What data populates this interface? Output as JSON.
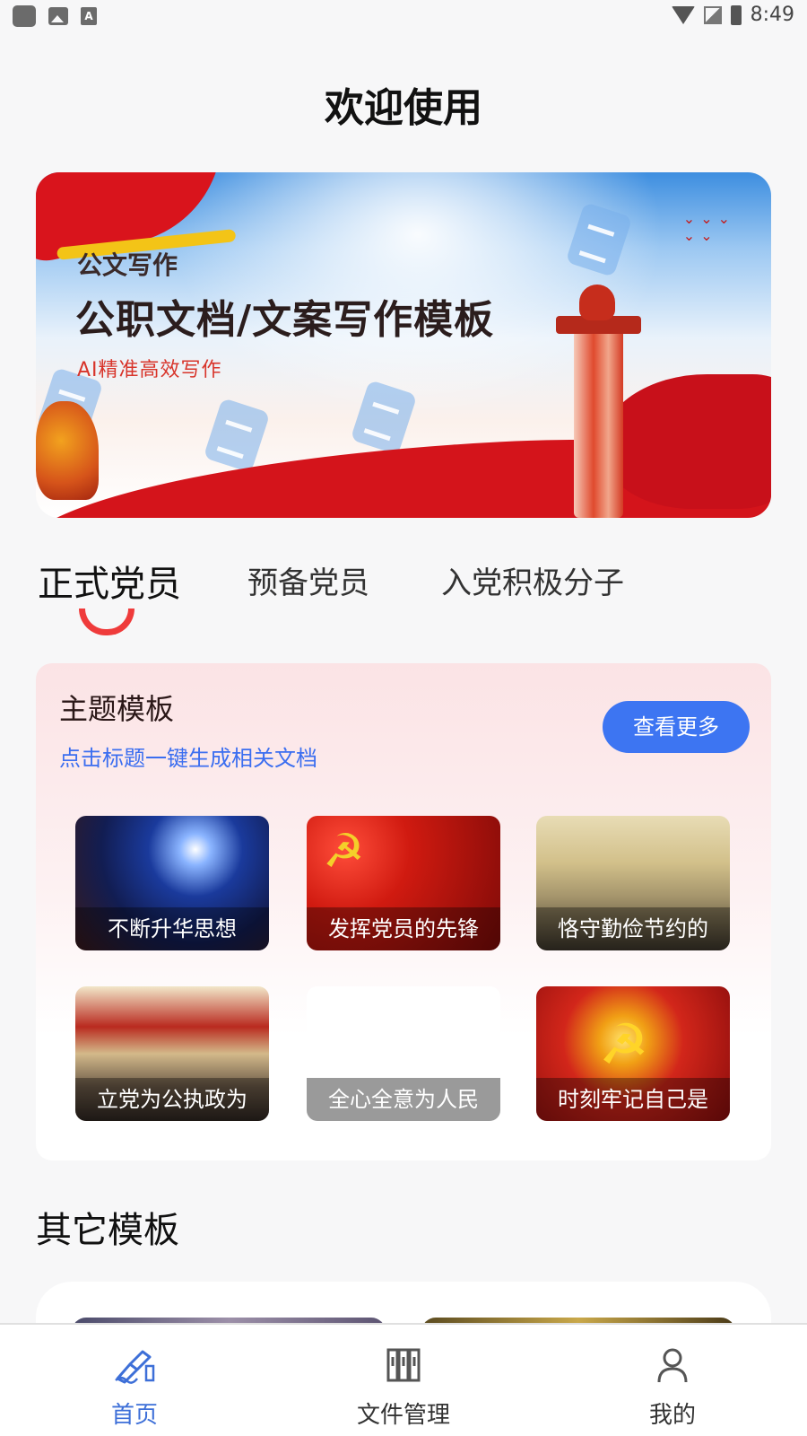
{
  "status_bar": {
    "time": "8:49",
    "left_badge": "A"
  },
  "page_title": "欢迎使用",
  "banner": {
    "label_small": "公文写作",
    "title": "公职文档/文案写作模板",
    "tagline": "AI精准高效写作"
  },
  "tabs": [
    {
      "label": "正式党员",
      "active": true
    },
    {
      "label": "预备党员",
      "active": false
    },
    {
      "label": "入党积极分子",
      "active": false
    }
  ],
  "theme_section": {
    "title": "主题模板",
    "subtitle": "点击标题一键生成相关文档",
    "more_button": "查看更多",
    "tiles": [
      {
        "caption": "不断升华思想"
      },
      {
        "caption": "发挥党员的先锋"
      },
      {
        "caption": "恪守勤俭节约的"
      },
      {
        "caption": "立党为公执政为"
      },
      {
        "caption": "全心全意为人民"
      },
      {
        "caption": "时刻牢记自己是"
      }
    ]
  },
  "other_section": {
    "title": "其它模板"
  },
  "bottom_nav": [
    {
      "label": "首页",
      "icon": "pen-write-icon",
      "active": true
    },
    {
      "label": "文件管理",
      "icon": "binders-icon",
      "active": false
    },
    {
      "label": "我的",
      "icon": "user-icon",
      "active": false
    }
  ],
  "colors": {
    "accent_blue": "#3d75f2",
    "accent_red": "#ef3b3b",
    "subtitle_blue": "#3b6ef0"
  }
}
